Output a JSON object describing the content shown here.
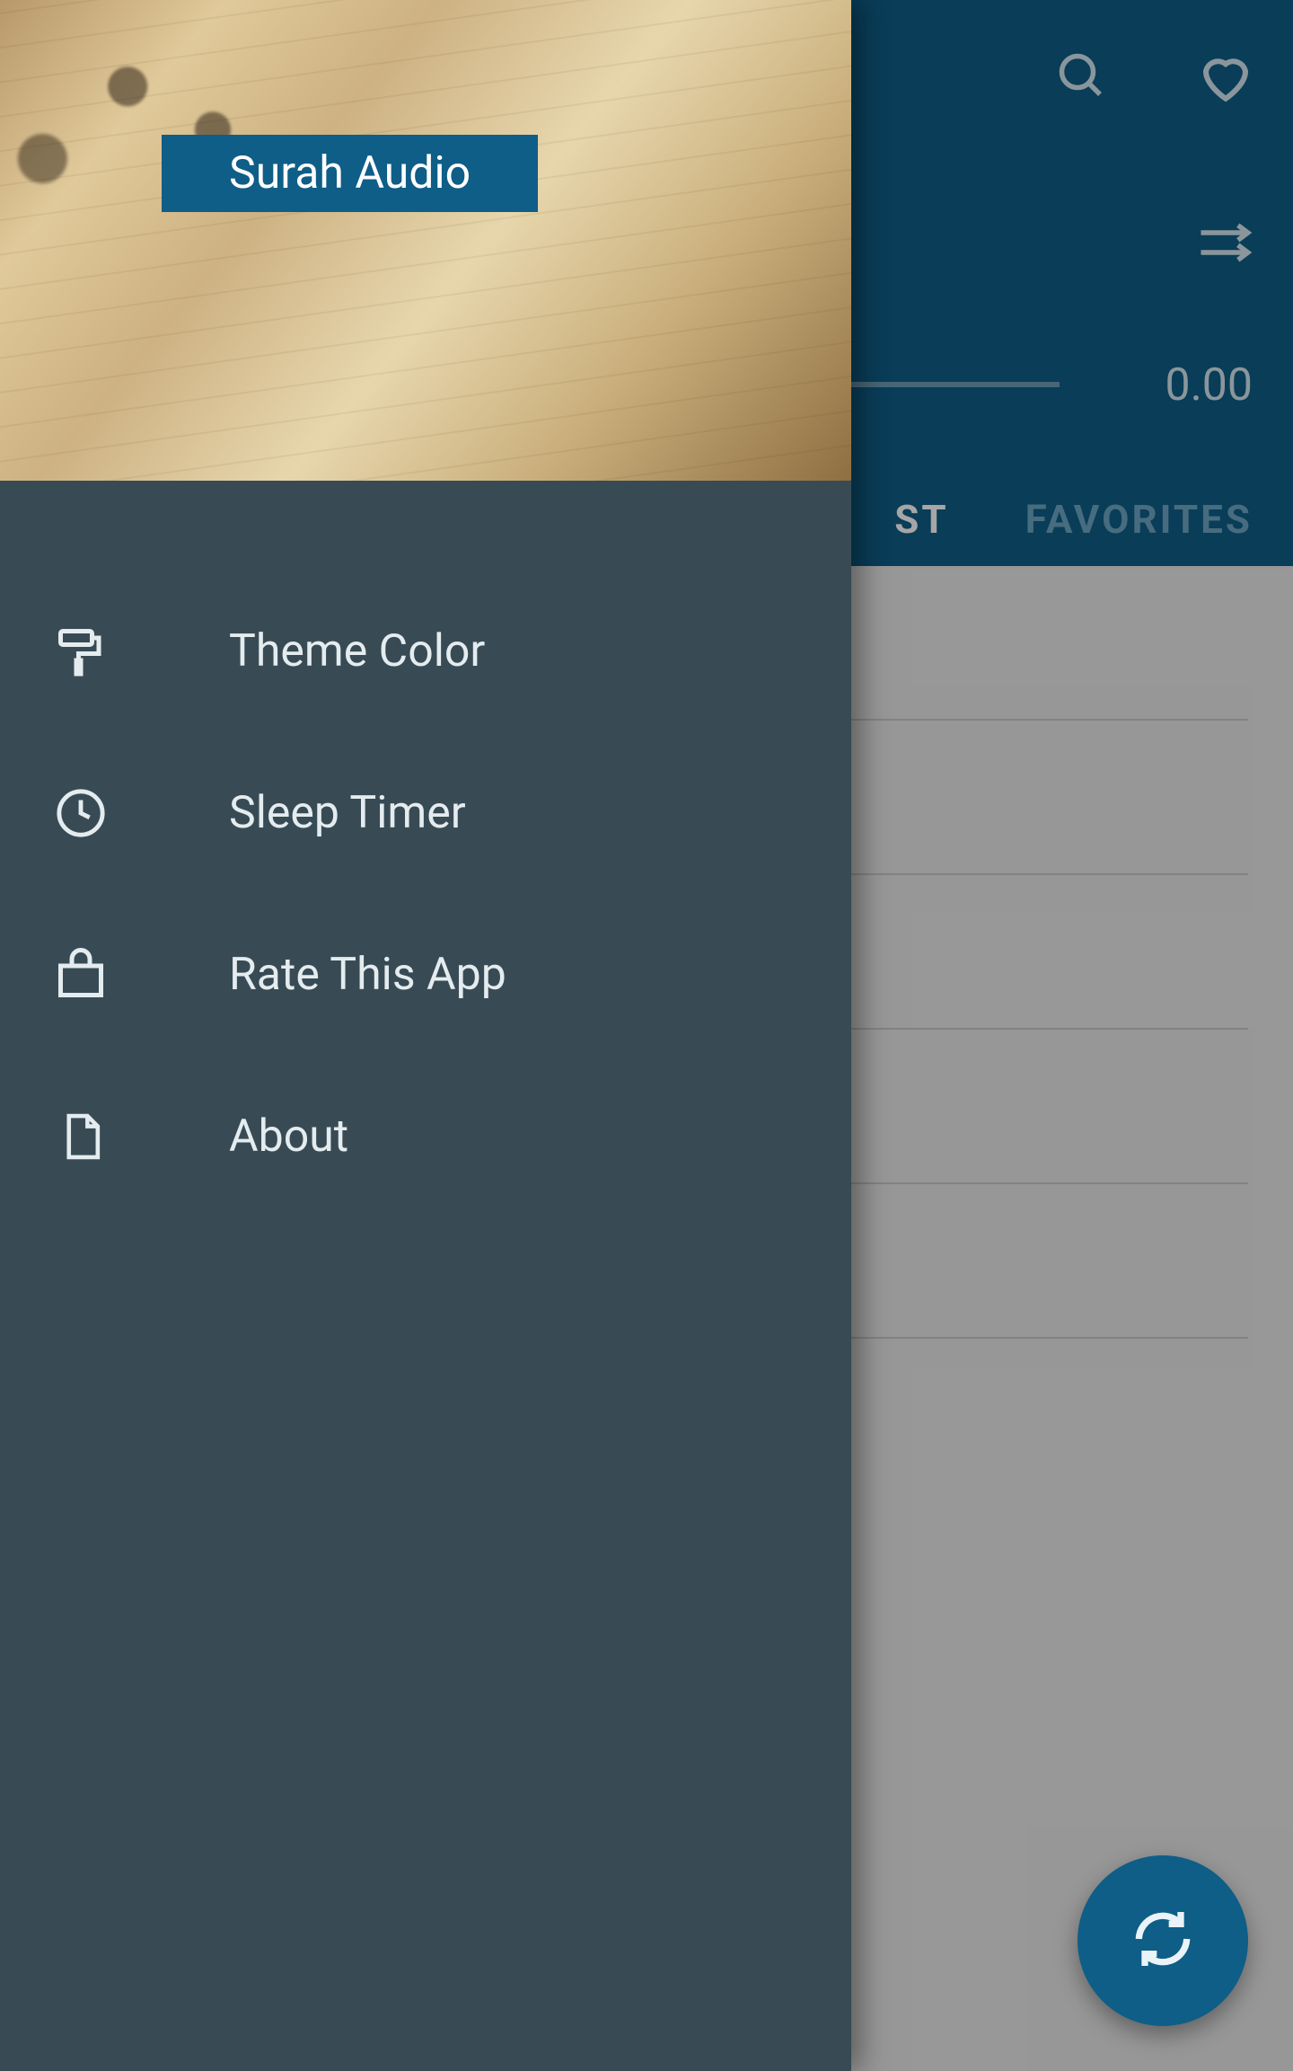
{
  "app": {
    "title": "Surah Audio"
  },
  "player": {
    "time": "0.00"
  },
  "tabs": {
    "active_partial": "ST",
    "favorites": "FAVORITES"
  },
  "drawer": {
    "items": [
      {
        "label": "Theme Color",
        "icon": "paint-roller-icon"
      },
      {
        "label": "Sleep Timer",
        "icon": "clock-icon"
      },
      {
        "label": "Rate This App",
        "icon": "bag-icon"
      },
      {
        "label": "About",
        "icon": "document-icon"
      }
    ]
  },
  "icons": {
    "search": "search-icon",
    "heart": "heart-icon",
    "repeat": "repeat-icon",
    "refresh": "refresh-icon"
  }
}
